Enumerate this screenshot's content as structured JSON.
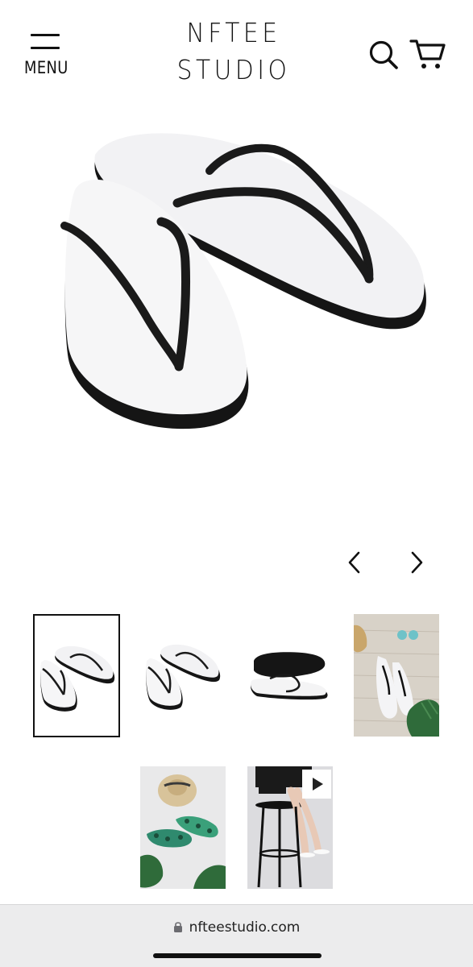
{
  "header": {
    "menu_label": "MENU",
    "brand_line1": "NFTEE",
    "brand_line2": "STUDIO",
    "search_icon": "search-icon",
    "cart_icon": "cart-icon"
  },
  "gallery": {
    "main_image": "white-flip-flops-black-straps",
    "prev_icon": "chevron-left-icon",
    "next_icon": "chevron-right-icon",
    "thumbnails": [
      {
        "subject": "white-flip-flops-angle",
        "selected": true
      },
      {
        "subject": "white-flip-flops-angle-alt",
        "selected": false
      },
      {
        "subject": "flip-flop-sole-bottom",
        "selected": false
      },
      {
        "subject": "flip-flops-on-wooden-deck-with-sunglasses",
        "selected": false
      },
      {
        "subject": "tropical-print-flip-flops-with-hat",
        "selected": false
      },
      {
        "subject": "model-sitting-on-stool-video",
        "selected": false,
        "video": true
      }
    ]
  },
  "browser": {
    "url": "nfteestudio.com",
    "lock_icon": "lock-icon"
  },
  "colors": {
    "text": "#111111",
    "browser_bar": "#ececed",
    "sole": "#f2f2f4",
    "strap": "#1a1a1a"
  }
}
